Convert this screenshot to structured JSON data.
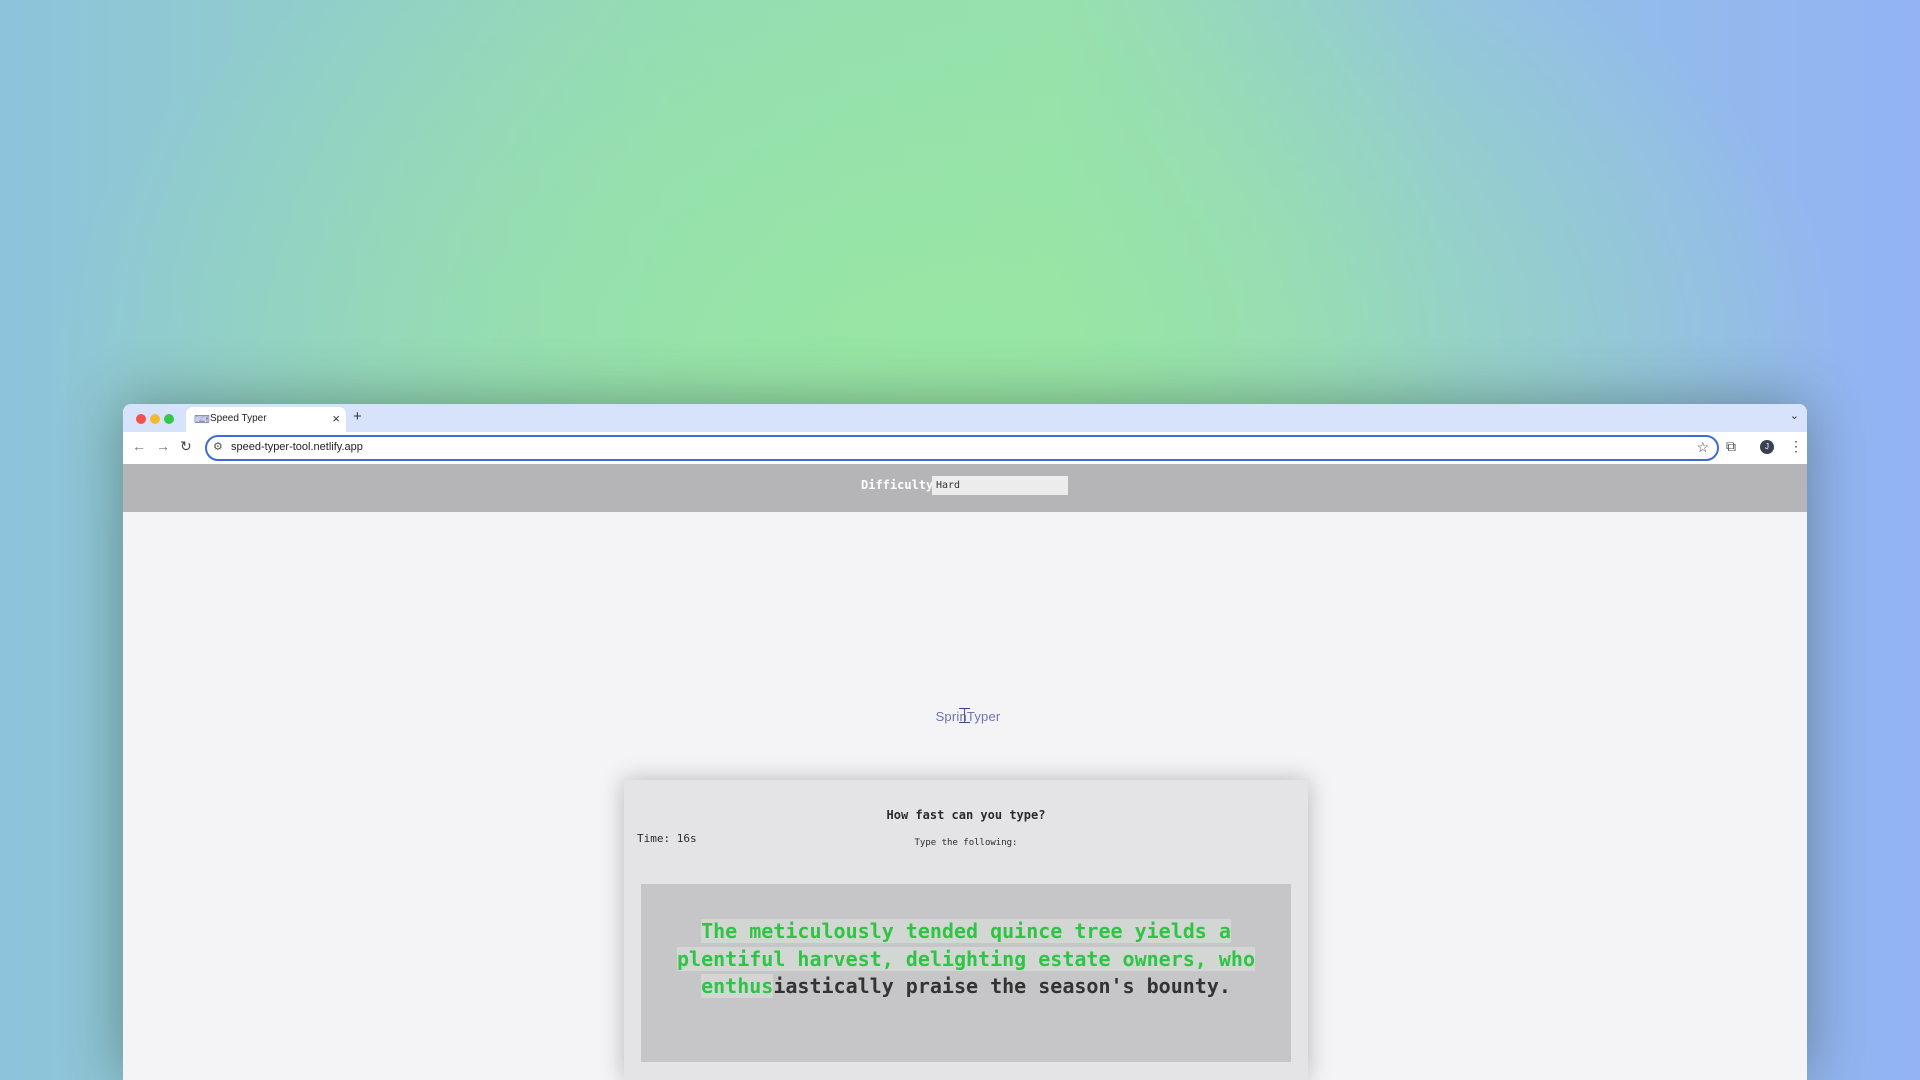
{
  "browser": {
    "tab_title": "Speed Typer",
    "url": "speed-typer-tool.netlify.app"
  },
  "difficulty": {
    "label": "Difficulty",
    "selected": "Hard"
  },
  "logo": {
    "text": "SprinTyper"
  },
  "game": {
    "title": "How fast can you type?",
    "time_label": "Time: 16s",
    "instruction": "Type the following:",
    "typed_text": "The meticulously tended quince tree yields a plentiful harvest, delighting estate owners, who enthus",
    "remaining_text": "iastically praise the season's bounty."
  },
  "colors": {
    "typed_text": "#2fc445",
    "url_focus": "#3f6ad8",
    "header_bar": "#b5b5b7"
  }
}
